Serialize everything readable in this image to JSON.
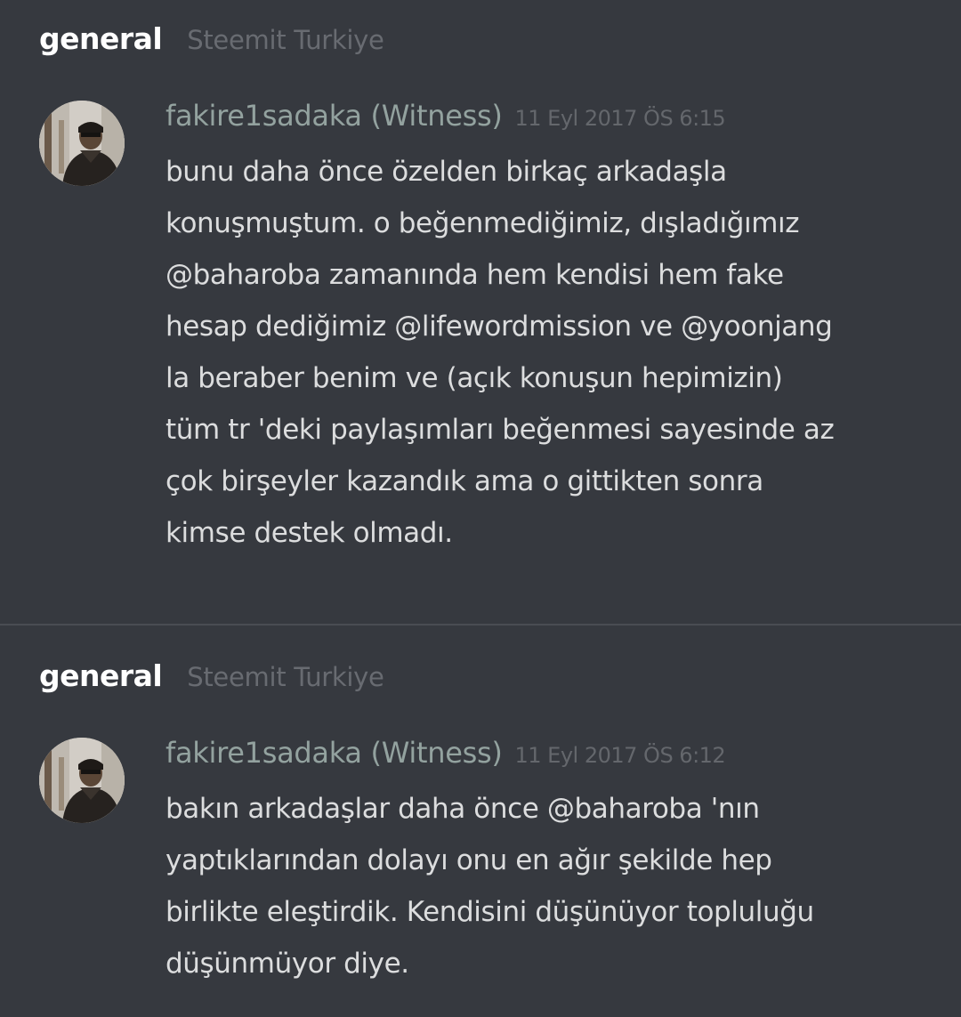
{
  "messages": [
    {
      "channel": "general",
      "server": "Steemit Turkiye",
      "author": "fakire1sadaka (Witness)",
      "timestamp": "11 Eyl 2017 ÖS 6:15",
      "lines": [
        "bunu daha önce özelden birkaç arkadaşla",
        "konuşmuştum. o beğenmediğimiz, dışladığımız",
        "@baharoba zamanında hem kendisi hem fake",
        "hesap dediğimiz @lifewordmission ve @yoonjang",
        "la beraber benim ve (açık konuşun hepimizin)",
        "tüm tr 'deki paylaşımları beğenmesi sayesinde az",
        "çok birşeyler kazandık ama o gittikten sonra",
        "kimse destek olmadı."
      ]
    },
    {
      "channel": "general",
      "server": "Steemit Turkiye",
      "author": "fakire1sadaka (Witness)",
      "timestamp": "11 Eyl 2017 ÖS 6:12",
      "lines": [
        "bakın arkadaşlar daha önce @baharoba 'nın",
        "yaptıklarından dolayı onu en ağır şekilde hep",
        "birlikte eleştirdik. Kendisini düşünüyor topluluğu",
        "düşünmüyor diye."
      ]
    }
  ]
}
